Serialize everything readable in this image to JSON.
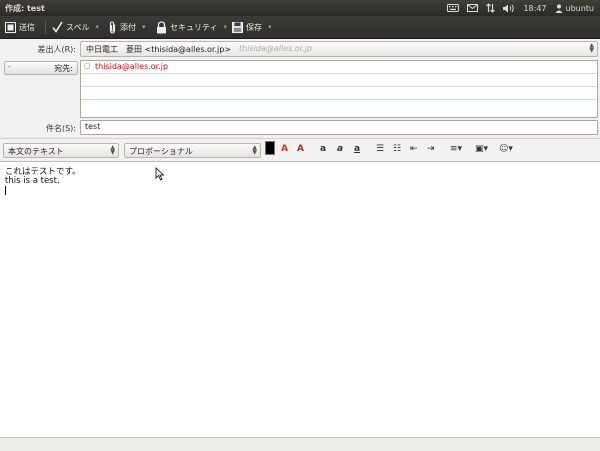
{
  "window": {
    "title": "作成: test"
  },
  "tray": {
    "time": "18:47",
    "user": "ubuntu"
  },
  "toolbar": {
    "send": "送信",
    "spell": "スペル",
    "attach": "添付",
    "security": "セキュリティ",
    "save": "保存"
  },
  "header": {
    "from_label": "差出人(R):",
    "from_value": "中日電工　菱田 <thisida@alles.or.jp>",
    "from_placeholder": "thisida@alles.or.jp",
    "to_label": "宛先:",
    "recipients": [
      "thisida@alles.or.jp"
    ],
    "subject_label": "件名(S):",
    "subject_value": "test"
  },
  "format": {
    "paragraph_style": "本文のテキスト",
    "font": "プロポーショナル"
  },
  "body": {
    "lines": [
      "これはテストです。",
      "this is a test."
    ]
  }
}
